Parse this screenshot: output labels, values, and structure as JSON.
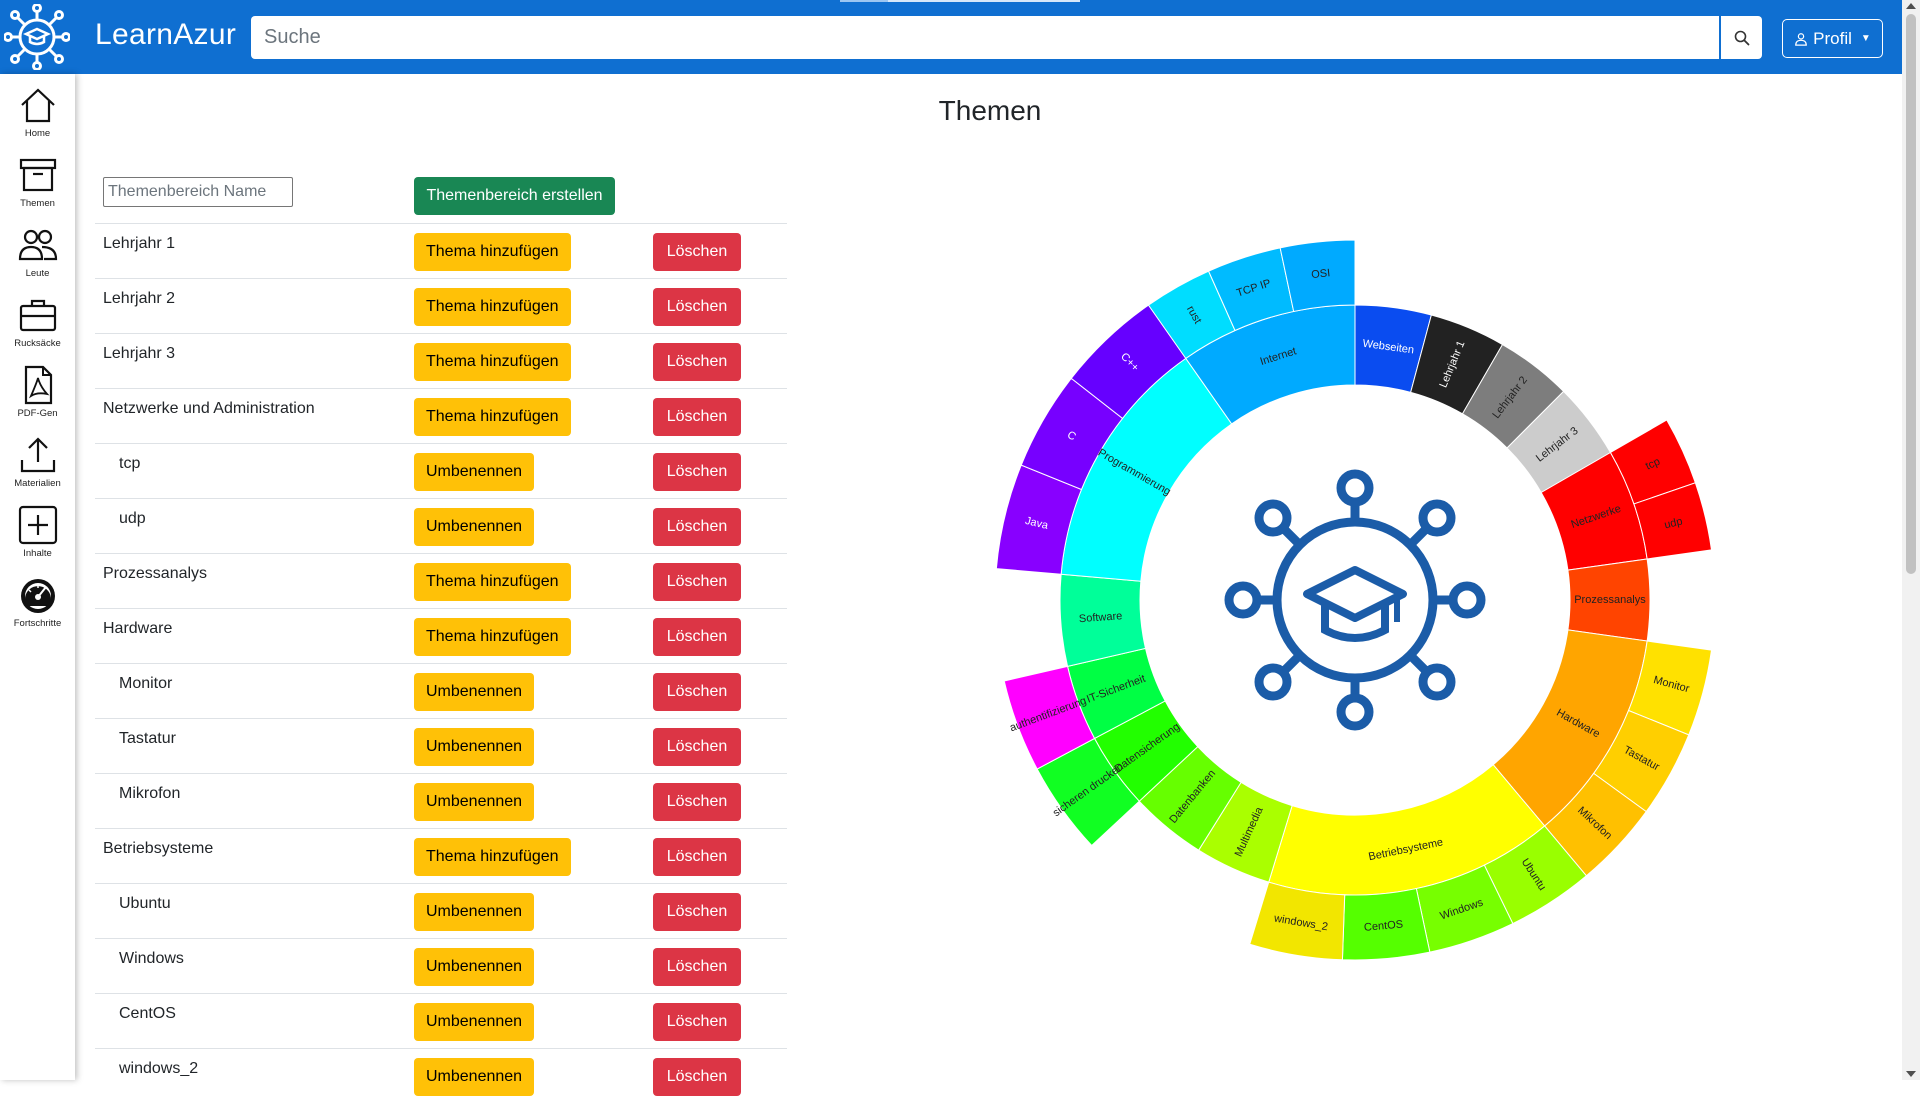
{
  "app": {
    "brand": "LearnAzur",
    "search_placeholder": "Suche",
    "profile_label": "Profil"
  },
  "sidebar": {
    "items": [
      {
        "label": "Home",
        "icon": "home-icon"
      },
      {
        "label": "Themen",
        "icon": "archive-icon"
      },
      {
        "label": "Leute",
        "icon": "people-icon"
      },
      {
        "label": "Rucksäcke",
        "icon": "briefcase-icon"
      },
      {
        "label": "PDF-Gen",
        "icon": "pdf-icon"
      },
      {
        "label": "Materialien",
        "icon": "upload-icon"
      },
      {
        "label": "Inhalte",
        "icon": "plus-square-icon"
      },
      {
        "label": "Fortschritte",
        "icon": "speedometer-icon"
      }
    ]
  },
  "main": {
    "title": "Themen",
    "name_placeholder": "Themenbereich Name",
    "create_label": "Themenbereich erstellen",
    "add_label": "Thema hinzufügen",
    "rename_label": "Umbenennen",
    "delete_label": "Löschen",
    "rows": [
      {
        "name": "Lehrjahr 1",
        "level": 0
      },
      {
        "name": "Lehrjahr 2",
        "level": 0
      },
      {
        "name": "Lehrjahr 3",
        "level": 0
      },
      {
        "name": "Netzwerke und Administration",
        "level": 0
      },
      {
        "name": "tcp",
        "level": 1
      },
      {
        "name": "udp",
        "level": 1
      },
      {
        "name": "Prozessanalys",
        "level": 0
      },
      {
        "name": "Hardware",
        "level": 0
      },
      {
        "name": "Monitor",
        "level": 1
      },
      {
        "name": "Tastatur",
        "level": 1
      },
      {
        "name": "Mikrofon",
        "level": 1
      },
      {
        "name": "Betriebsysteme",
        "level": 0
      },
      {
        "name": "Ubuntu",
        "level": 1
      },
      {
        "name": "Windows",
        "level": 1
      },
      {
        "name": "CentOS",
        "level": 1
      },
      {
        "name": "windows_2",
        "level": 1
      }
    ]
  },
  "chart_data": {
    "type": "sunburst",
    "inner": [
      {
        "label": "Webseiten",
        "start": 0,
        "end": 15,
        "color": "#0a4cf0"
      },
      {
        "label": "Lehrjahr 1",
        "start": 15,
        "end": 30,
        "color": "#222222"
      },
      {
        "label": "Lehrjahr 2",
        "start": 30,
        "end": 45,
        "color": "#7d7d7d"
      },
      {
        "label": "Lehrjahr 3",
        "start": 45,
        "end": 60,
        "color": "#cccccc"
      },
      {
        "label": "Netzwerke",
        "start": 60,
        "end": 82,
        "color": "#ff0000"
      },
      {
        "label": "Prozessanalys",
        "start": 82,
        "end": 98,
        "color": "#ff4400"
      },
      {
        "label": "Hardware",
        "start": 98,
        "end": 140,
        "color": "#ffa500"
      },
      {
        "label": "Betriebsysteme",
        "start": 140,
        "end": 197,
        "color": "#ffff00"
      },
      {
        "label": "Multimedia",
        "start": 197,
        "end": 212,
        "color": "#aaff00"
      },
      {
        "label": "Datenbanken",
        "start": 212,
        "end": 227,
        "color": "#66ff00"
      },
      {
        "label": "Datensicherung",
        "start": 227,
        "end": 242,
        "color": "#22ff00"
      },
      {
        "label": "IT-Sicherheit",
        "start": 242,
        "end": 257,
        "color": "#00ff44"
      },
      {
        "label": "Software",
        "start": 257,
        "end": 275,
        "color": "#00ff99"
      },
      {
        "label": "Programmierung",
        "start": 275,
        "end": 325,
        "color": "#00ffff"
      },
      {
        "label": "Internet",
        "start": 325,
        "end": 360,
        "color": "#00aaff"
      }
    ],
    "outer": [
      {
        "label": "tcp",
        "start": 60,
        "end": 71,
        "color": "#ff0000"
      },
      {
        "label": "udp",
        "start": 71,
        "end": 82,
        "color": "#ff0000"
      },
      {
        "label": "Monitor",
        "start": 98,
        "end": 112,
        "color": "#ffe100"
      },
      {
        "label": "Tastatur",
        "start": 112,
        "end": 126,
        "color": "#ffcf00"
      },
      {
        "label": "Mikrofon",
        "start": 126,
        "end": 140,
        "color": "#ffc000"
      },
      {
        "label": "Ubuntu",
        "start": 140,
        "end": 154,
        "color": "#99ff00"
      },
      {
        "label": "Windows",
        "start": 154,
        "end": 168,
        "color": "#77ff00"
      },
      {
        "label": "CentOS",
        "start": 168,
        "end": 182,
        "color": "#55ff00"
      },
      {
        "label": "windows_2",
        "start": 182,
        "end": 197,
        "color": "#f2e600"
      },
      {
        "label": "sicheren drucken",
        "start": 227,
        "end": 242,
        "color": "#11ff22"
      },
      {
        "label": "authentifizierung",
        "start": 242,
        "end": 257,
        "color": "#ff00ff"
      },
      {
        "label": "Java",
        "start": 275,
        "end": 292,
        "color": "#8800ff"
      },
      {
        "label": "C",
        "start": 292,
        "end": 308,
        "color": "#7700ff"
      },
      {
        "label": "C++",
        "start": 308,
        "end": 325,
        "color": "#6600ff"
      },
      {
        "label": "rust",
        "start": 325,
        "end": 336,
        "color": "#00ddff"
      },
      {
        "label": "TCP IP",
        "start": 336,
        "end": 348,
        "color": "#00bbff"
      },
      {
        "label": "OSI",
        "start": 348,
        "end": 360,
        "color": "#00aaff"
      }
    ]
  }
}
